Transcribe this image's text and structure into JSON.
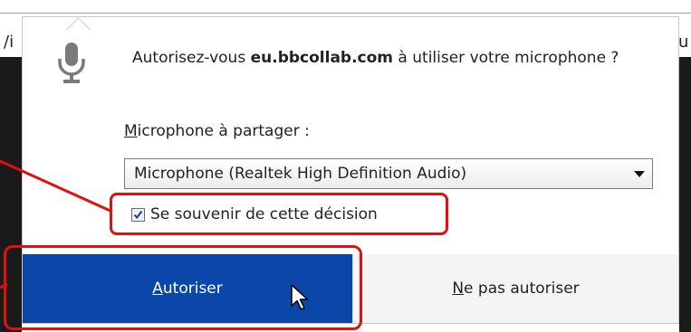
{
  "background": {
    "left_edge_text": "/i",
    "right_edge_text": "u"
  },
  "dialog": {
    "prompt_prefix": "Autorisez-vous ",
    "site": "eu.bbcollab.com",
    "prompt_suffix": " à utiliser votre microphone ?",
    "share_label_accesskey": "M",
    "share_label_rest": "icrophone à partager :",
    "selected_device": "Microphone (Realtek High Definition Audio)",
    "remember_label": "Se souvenir de cette décision",
    "remember_checked": true,
    "allow_accesskey": "A",
    "allow_rest": "utoriser",
    "deny_accesskey": "N",
    "deny_rest": "e pas autoriser"
  },
  "colors": {
    "allow_button": "#0a47a8",
    "annotation": "#e01010"
  },
  "icons": {
    "microphone": "microphone-icon",
    "dropdown": "chevron-down-icon",
    "checkmark": "checkmark-icon",
    "cursor": "mouse-cursor-icon"
  }
}
